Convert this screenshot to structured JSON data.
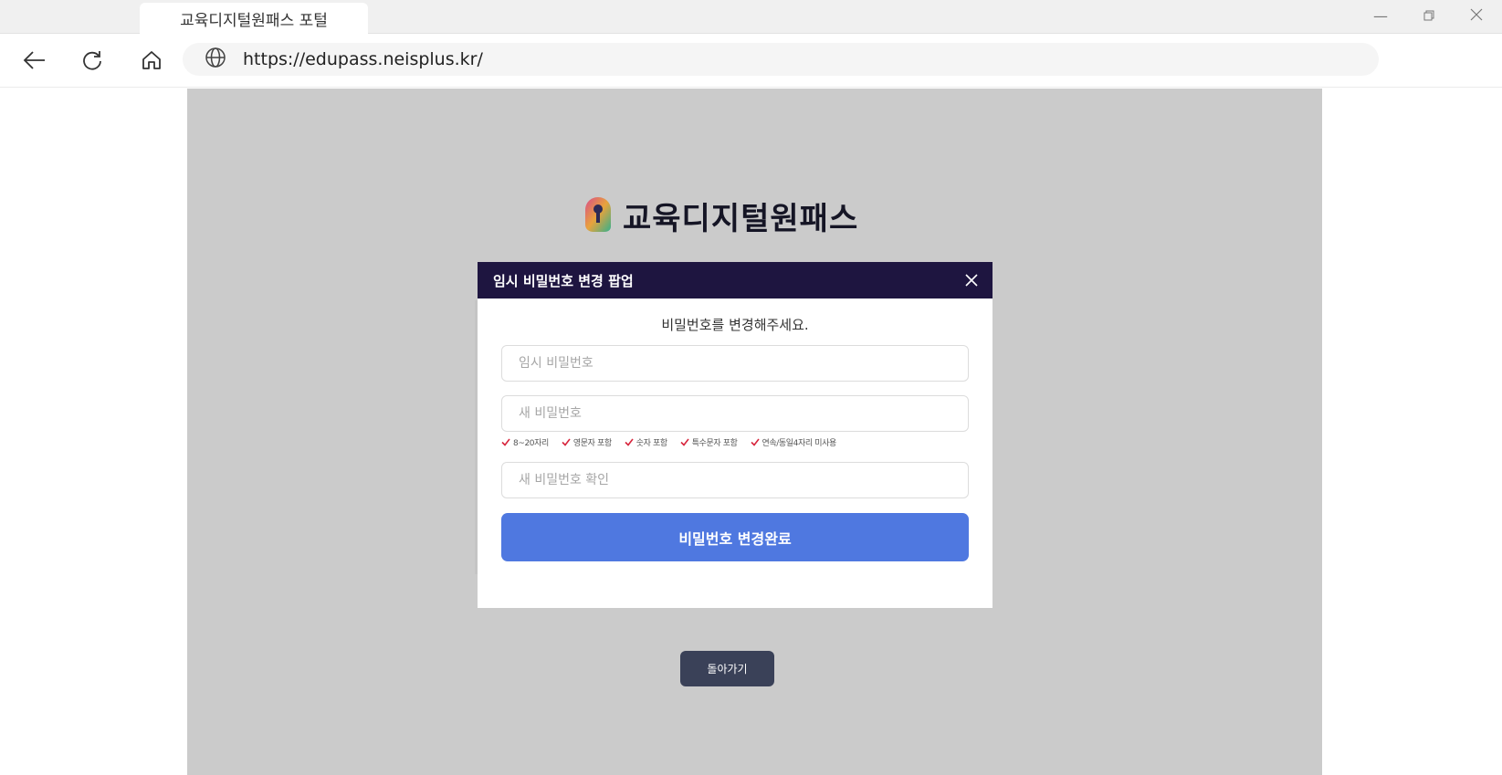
{
  "browser": {
    "tab_title": "교육디지털원패스 포털",
    "url": "https://edupass.neisplus.kr/"
  },
  "page": {
    "brand_name": "교육디지털원패스",
    "back_button": "돌아가기"
  },
  "modal": {
    "title": "임시 비밀번호 변경 팝업",
    "instruction": "비밀번호를 변경해주세요.",
    "temp_password_placeholder": "임시 비밀번호",
    "new_password_placeholder": "새 비밀번호",
    "confirm_password_placeholder": "새 비밀번호 확인",
    "rules": [
      "8~20자리",
      "영문자 포함",
      "숫자 포함",
      "특수문자 포함",
      "연속/동일4자리 미사용"
    ],
    "submit_label": "비밀번호 변경완료"
  },
  "colors": {
    "modal_header": "#1e1540",
    "submit_button": "#4f78e0",
    "rule_check": "#d7263d",
    "overlay": "#cbcbcb",
    "back_button": "#3a4158"
  }
}
